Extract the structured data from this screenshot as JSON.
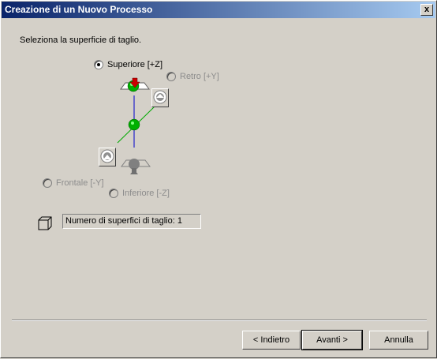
{
  "window": {
    "title": "Creazione di un Nuovo Processo",
    "close_label": "x"
  },
  "instruction": "Seleziona la superficie di taglio.",
  "surfaces": {
    "superiore": {
      "label": "Superiore [+Z]",
      "selected": true,
      "enabled": true
    },
    "retro": {
      "label": "Retro [+Y]",
      "selected": false,
      "enabled": false
    },
    "frontale": {
      "label": "Frontale [-Y]",
      "selected": false,
      "enabled": false
    },
    "inferiore": {
      "label": "Inferiore [-Z]",
      "selected": false,
      "enabled": false
    }
  },
  "cut_surface_count": "Numero di superfici di taglio: 1",
  "buttons": {
    "back": "< Indietro",
    "next": "Avanti >",
    "cancel": "Annulla"
  },
  "colors": {
    "axis_z": "#0000cc",
    "axis_y": "#00aa00",
    "sphere": "#00b000",
    "arrow": "#cc0000"
  },
  "icons": {
    "cube": "cube-icon",
    "retro_tool": "tool-view-icon",
    "frontale_tool": "tool-view-icon"
  }
}
